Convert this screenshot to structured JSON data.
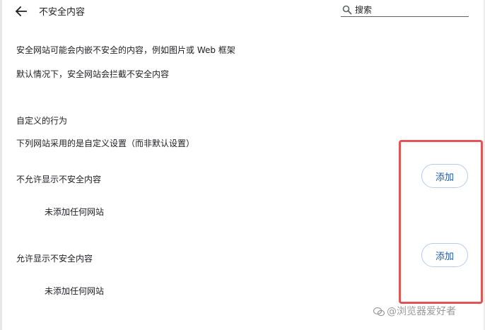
{
  "header": {
    "title": "不安全内容",
    "search_placeholder": "搜索"
  },
  "intro": {
    "line1": "安全网站可能会内嵌不安全的内容，例如图片或 Web 框架",
    "line2": "默认情况下，安全网站会拦截不安全内容"
  },
  "custom": {
    "heading": "自定义的行为",
    "subheading": "下列网站采用的是自定义设置（而非默认设置）"
  },
  "blocked_section": {
    "title": "不允许显示不安全内容",
    "add_label": "添加",
    "empty_text": "未添加任何网站"
  },
  "allowed_section": {
    "title": "允许显示不安全内容",
    "add_label": "添加",
    "empty_text": "未添加任何网站"
  },
  "watermark": {
    "text": "@浏览器爱好者"
  },
  "colors": {
    "highlight": "#e05555",
    "button_text": "#1a5aa8",
    "button_border": "#b9cbe8"
  }
}
